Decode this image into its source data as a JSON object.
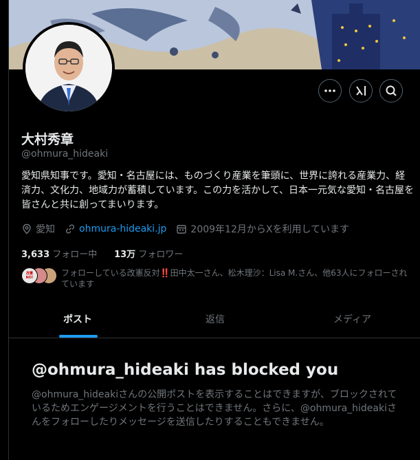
{
  "profile": {
    "name": "大村秀章",
    "handle": "@ohmura_hideaki",
    "bio": "愛知県知事です。愛知・名古屋には、ものづくり産業を筆頭に、世界に誇れる産業力、経済力、文化力、地域力が蓄積しています。この力を活かして、日本一元気な愛知・名古屋を皆さんと共に創ってまいります。",
    "location": "愛知",
    "website": "ohmura-hideaki.jp",
    "joined": "2009年12月からXを利用しています",
    "following_count": "3,633",
    "following_label": "フォロー中",
    "followers_count": "13万",
    "followers_label": "フォロワー",
    "known_followers": "フォローしている改憲反対‼️田中太一さん、松木理沙：Lisa M.さん、他63人にフォローされています",
    "mini_avatar_badge": "改憲NO!"
  },
  "actions": {
    "more_icon": "more-horizontal-icon",
    "grok_icon": "grok-icon",
    "search_icon": "search-icon"
  },
  "tabs": [
    {
      "label": "ポスト"
    },
    {
      "label": "返信"
    },
    {
      "label": "メディア"
    }
  ],
  "blocked": {
    "title": "@ohmura_hideaki has blocked you",
    "description": "@ohmura_hideakiさんの公開ポストを表示することはできますが、ブロックされているためエンゲージメントを行うことはできません。さらに、@ohmura_hideakiさんをフォローしたりメッセージを送信したりすることもできません。"
  },
  "colors": {
    "background": "#000000",
    "text": "#e7e9ea",
    "muted": "#71767b",
    "accent": "#1d9bf0",
    "border": "#2f3336"
  }
}
